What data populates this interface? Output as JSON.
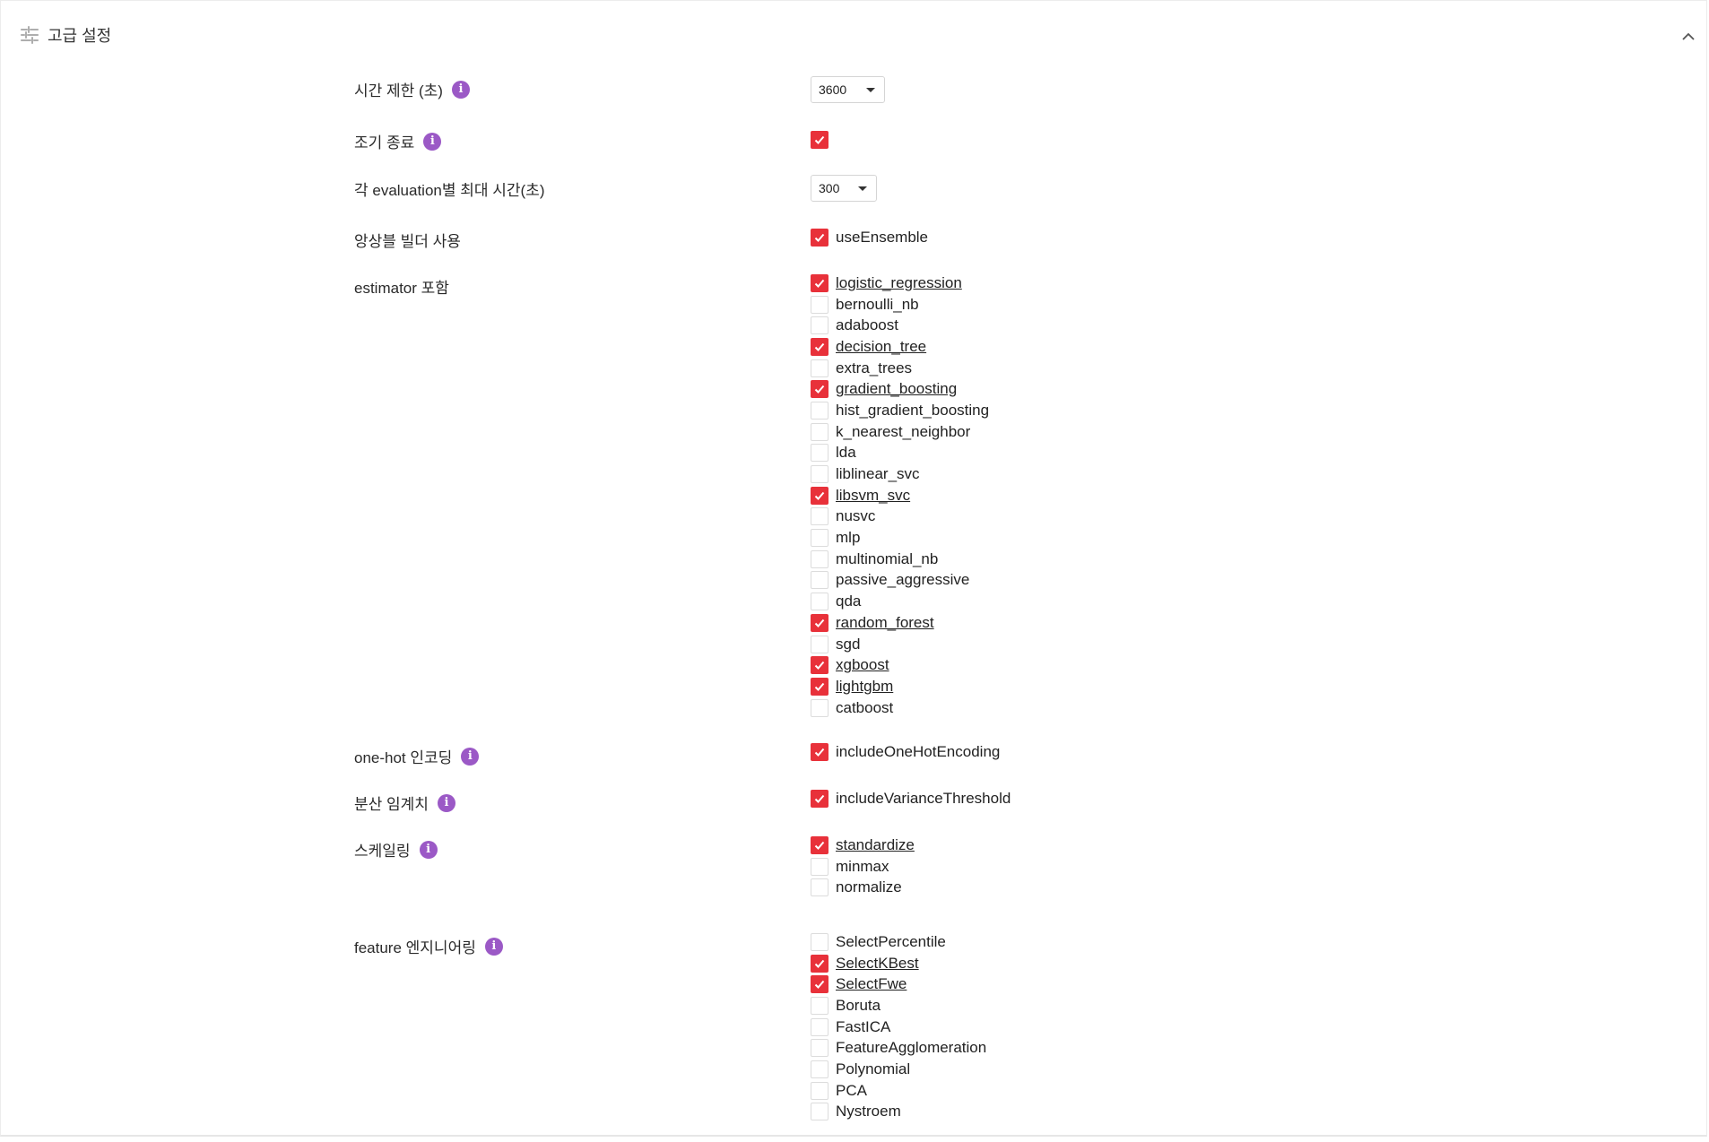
{
  "header": {
    "title": "고급 설정"
  },
  "time_limit": {
    "label": "시간 제한 (초)",
    "value": "3600"
  },
  "early_stop": {
    "label": "조기 종료",
    "checked": true
  },
  "eval_time": {
    "label": "각 evaluation별 최대 시간(초)",
    "value": "300"
  },
  "ensemble": {
    "label": "앙상블 빌더 사용",
    "option": "useEnsemble",
    "checked": true
  },
  "estimators": {
    "label": "estimator 포함",
    "items": [
      {
        "label": "logistic_regression",
        "checked": true
      },
      {
        "label": "bernoulli_nb",
        "checked": false
      },
      {
        "label": "adaboost",
        "checked": false
      },
      {
        "label": "decision_tree",
        "checked": true
      },
      {
        "label": "extra_trees",
        "checked": false
      },
      {
        "label": "gradient_boosting",
        "checked": true
      },
      {
        "label": "hist_gradient_boosting",
        "checked": false
      },
      {
        "label": "k_nearest_neighbor",
        "checked": false
      },
      {
        "label": "lda",
        "checked": false
      },
      {
        "label": "liblinear_svc",
        "checked": false
      },
      {
        "label": "libsvm_svc",
        "checked": true
      },
      {
        "label": "nusvc",
        "checked": false
      },
      {
        "label": "mlp",
        "checked": false
      },
      {
        "label": "multinomial_nb",
        "checked": false
      },
      {
        "label": "passive_aggressive",
        "checked": false
      },
      {
        "label": "qda",
        "checked": false
      },
      {
        "label": "random_forest",
        "checked": true
      },
      {
        "label": "sgd",
        "checked": false
      },
      {
        "label": "xgboost",
        "checked": true
      },
      {
        "label": "lightgbm",
        "checked": true
      },
      {
        "label": "catboost",
        "checked": false
      }
    ]
  },
  "onehot": {
    "label": "one-hot 인코딩",
    "option": "includeOneHotEncoding",
    "checked": true
  },
  "variance": {
    "label": "분산 임계치",
    "option": "includeVarianceThreshold",
    "checked": true
  },
  "scaling": {
    "label": "스케일링",
    "items": [
      {
        "label": "standardize",
        "checked": true
      },
      {
        "label": "minmax",
        "checked": false
      },
      {
        "label": "normalize",
        "checked": false
      }
    ]
  },
  "feature_eng": {
    "label": "feature 엔지니어링",
    "items": [
      {
        "label": "SelectPercentile",
        "checked": false
      },
      {
        "label": "SelectKBest",
        "checked": true
      },
      {
        "label": "SelectFwe",
        "checked": true
      },
      {
        "label": "Boruta",
        "checked": false
      },
      {
        "label": "FastICA",
        "checked": false
      },
      {
        "label": "FeatureAgglomeration",
        "checked": false
      },
      {
        "label": "Polynomial",
        "checked": false
      },
      {
        "label": "PCA",
        "checked": false
      },
      {
        "label": "Nystroem",
        "checked": false
      }
    ]
  },
  "colors": {
    "checkbox_checked": "#e8313a",
    "info_icon": "#9b59c6"
  },
  "icons": {
    "header": "tune-icon",
    "collapse": "chevron-up-icon",
    "info": "info-icon",
    "check": "check-icon"
  }
}
